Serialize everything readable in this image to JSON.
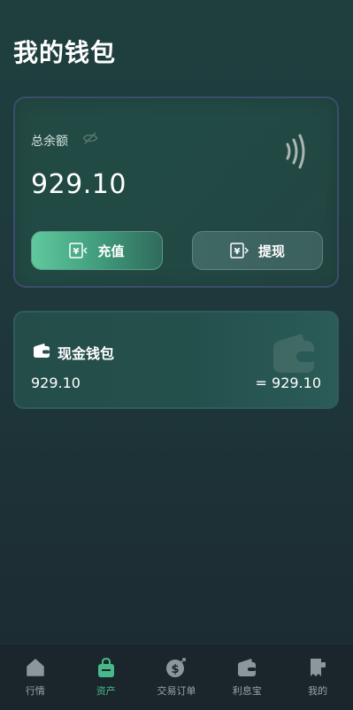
{
  "page": {
    "title": "我的钱包"
  },
  "balance_card": {
    "label": "总余额",
    "amount": "929.10",
    "visibility_icon": "eye-off-icon",
    "contactless_icon": "nfc-icon",
    "buttons": [
      {
        "label": "充值",
        "icon": "recharge-yen-icon"
      },
      {
        "label": "提现",
        "icon": "withdraw-yen-icon"
      }
    ]
  },
  "cash_wallet": {
    "title": "现金钱包",
    "amount": "929.10",
    "converted": "= 929.10",
    "icon": "wallet-icon"
  },
  "tabbar": {
    "active_index": 1,
    "items": [
      {
        "label": "行情",
        "icon": "home-icon"
      },
      {
        "label": "资产",
        "icon": "bag-icon"
      },
      {
        "label": "交易订单",
        "icon": "dollar-coin-icon"
      },
      {
        "label": "利息宝",
        "icon": "wallet-card-icon"
      },
      {
        "label": "我的",
        "icon": "profile-receipt-icon"
      }
    ]
  },
  "colors": {
    "accent": "#48b988",
    "background": "#1e3a3d",
    "tab_inactive": "#9aa4a8"
  }
}
